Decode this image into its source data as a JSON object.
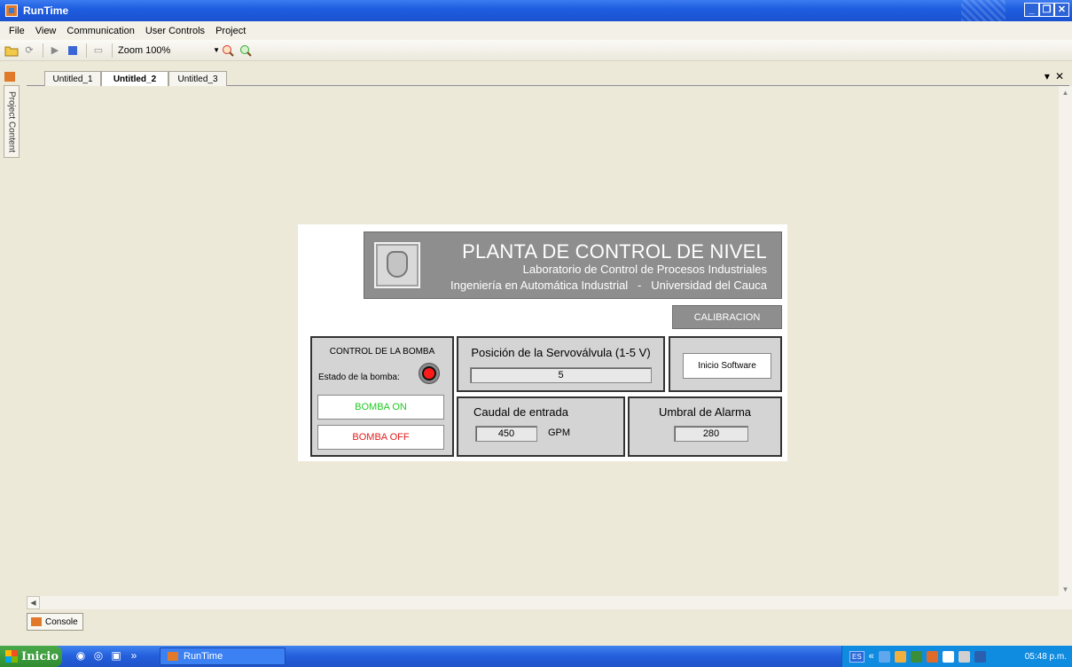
{
  "window": {
    "title": "RunTime"
  },
  "menu": [
    "File",
    "View",
    "Communication",
    "User Controls",
    "Project"
  ],
  "toolbar": {
    "zoom_label": "Zoom 100%"
  },
  "side_tab": "Project Content",
  "doc_tabs": [
    "Untitled_1",
    "Untitled_2",
    "Untitled_3"
  ],
  "active_tab": "Untitled_2",
  "panel": {
    "header": {
      "title": "PLANTA DE CONTROL DE NIVEL",
      "subtitle": "Laboratorio de Control de Procesos Industriales",
      "line3": "Ingeniería en Automática Industrial   -   Universidad del Cauca"
    },
    "calibracion_label": "CALIBRACION",
    "bomba": {
      "title": "CONTROL DE LA BOMBA",
      "estado_label": "Estado de la bomba:",
      "led_color": "#ff1a1a",
      "on_label": "BOMBA ON",
      "off_label": "BOMBA OFF",
      "on_color": "#22c922",
      "off_color": "#e21b1b"
    },
    "servo": {
      "title": "Posición de la Servoválvula (1-5 V)",
      "value": "5"
    },
    "inicio_label": "Inicio Software",
    "caudal": {
      "title": "Caudal de entrada",
      "value": "450",
      "unit": "GPM"
    },
    "umbral": {
      "title": "Umbral de Alarma",
      "value": "280"
    }
  },
  "bottom_tab": "Console",
  "taskbar": {
    "start_label": "Inicio",
    "task_label": "RunTime",
    "lang": "ES",
    "clock": "05:48 p.m."
  }
}
